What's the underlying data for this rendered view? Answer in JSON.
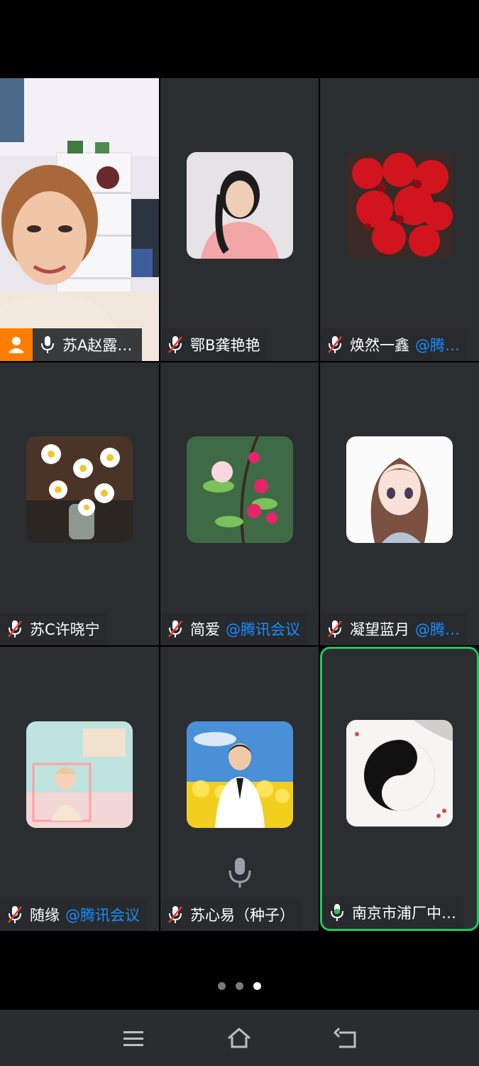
{
  "participants": [
    {
      "name": "苏A赵露…",
      "tag": "",
      "mic": "on",
      "host": true,
      "video": true
    },
    {
      "name": "鄂B龚艳艳",
      "tag": "",
      "mic": "muted",
      "host": false
    },
    {
      "name": "焕然一鑫",
      "tag": "@腾…",
      "mic": "muted",
      "host": false
    },
    {
      "name": "苏C许晓宁",
      "tag": "",
      "mic": "muted",
      "host": false
    },
    {
      "name": "简爱",
      "tag": "@腾讯会议",
      "mic": "muted",
      "host": false
    },
    {
      "name": "凝望蓝月",
      "tag": "@腾…",
      "mic": "muted",
      "host": false
    },
    {
      "name": "随缘",
      "tag": "@腾讯会议",
      "mic": "muted",
      "host": false
    },
    {
      "name": "苏心易（种子）",
      "tag": "",
      "mic": "muted",
      "host": false
    },
    {
      "name": "南京市浦厂中…",
      "tag": "",
      "mic": "speaking",
      "host": false,
      "speaking": true
    }
  ],
  "pager": {
    "count": 3,
    "active": 3
  },
  "nav": {
    "menu_icon": "menu-icon",
    "home_icon": "home-icon",
    "back_icon": "back-icon"
  },
  "colors": {
    "accent_speaking": "#22c55e",
    "tag_blue": "#1a8cff",
    "host_orange": "#ff7d00"
  }
}
